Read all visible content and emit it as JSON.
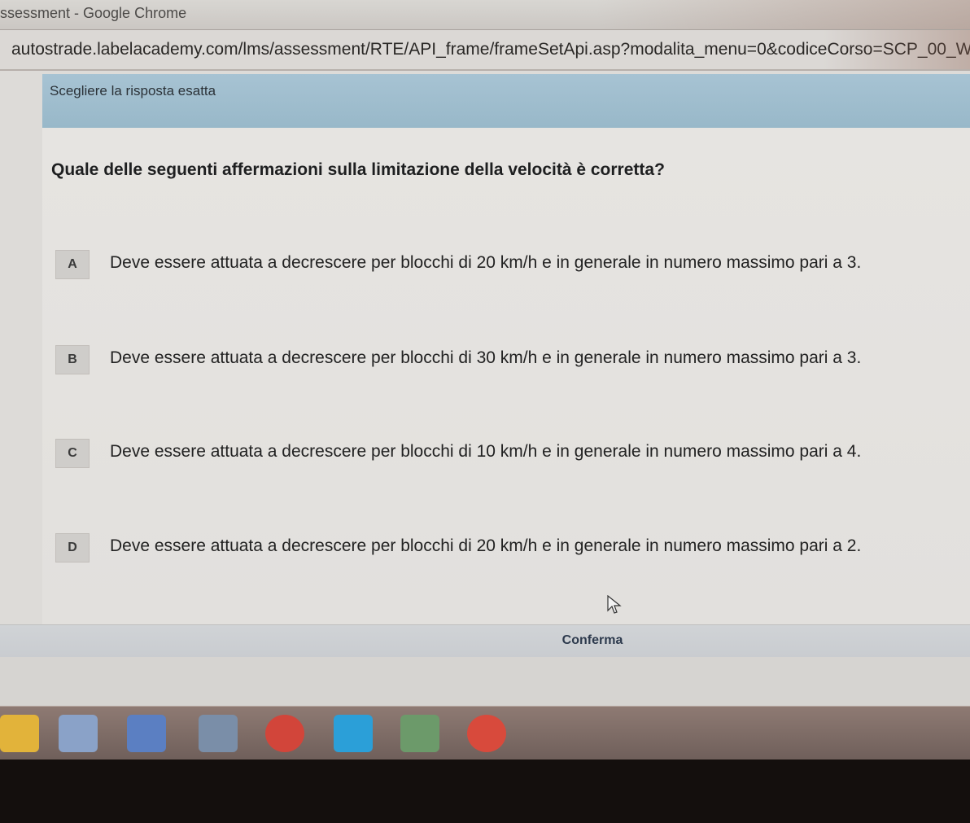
{
  "window": {
    "title": "ssessment - Google Chrome"
  },
  "browser": {
    "url": "autostrade.labelacademy.com/lms/assessment/RTE/API_frame/frameSetApi.asp?modalita_menu=0&codiceCorso=SCP_00_W"
  },
  "assessment": {
    "instruction": "Scegliere la risposta esatta",
    "question": "Quale delle seguenti affermazioni sulla limitazione della velocità è corretta?",
    "answers": [
      {
        "letter": "A",
        "text": "Deve essere attuata a decrescere per blocchi di 20 km/h e in generale in numero massimo pari a 3."
      },
      {
        "letter": "B",
        "text": "Deve essere attuata a decrescere per blocchi di 30 km/h e in generale in numero massimo pari a 3."
      },
      {
        "letter": "C",
        "text": "Deve essere attuata a decrescere per blocchi di 10 km/h e in generale in numero massimo pari a 4."
      },
      {
        "letter": "D",
        "text": "Deve essere attuata a decrescere per blocchi di 20 km/h e in generale in numero massimo pari a 2."
      }
    ],
    "confirm_label": "Conferma"
  },
  "taskbar": {
    "icons": [
      {
        "name": "explorer-icon",
        "color": "#e2b33a"
      },
      {
        "name": "snipping-tool-icon",
        "color": "#8aa2c8"
      },
      {
        "name": "media-player-icon",
        "color": "#5b7fc2"
      },
      {
        "name": "paint-icon",
        "color": "#7a8ea8"
      },
      {
        "name": "chrome-icon",
        "color": "#d2453a"
      },
      {
        "name": "skype-icon",
        "color": "#2b9fd8"
      },
      {
        "name": "people-icon",
        "color": "#6c9a6a"
      },
      {
        "name": "chrome-profile-icon",
        "color": "#d84a3c"
      }
    ]
  },
  "colors": {
    "instruction_bar": "#a7c3d3",
    "confirm_bar": "#cdd0d3",
    "question_text": "#1e1f20"
  }
}
